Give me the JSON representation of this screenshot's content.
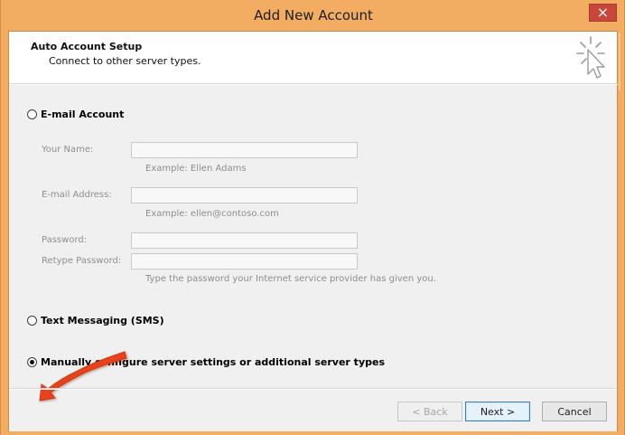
{
  "window": {
    "title": "Add New Account",
    "close_icon": "close-icon"
  },
  "header": {
    "title": "Auto Account Setup",
    "subtitle": "Connect to other server types.",
    "icon": "wizard-cursor-icon"
  },
  "options": {
    "email_account_label": "E-mail Account",
    "text_messaging_label": "Text Messaging (SMS)",
    "manual_label": "Manually configure server settings or additional server types"
  },
  "email_form": {
    "your_name_label": "Your Name:",
    "your_name_value": "",
    "your_name_example": "Example: Ellen Adams",
    "email_label": "E-mail Address:",
    "email_value": "",
    "email_example": "Example: ellen@contoso.com",
    "password_label": "Password:",
    "password_value": "",
    "retype_password_label": "Retype Password:",
    "retype_password_value": "",
    "password_hint": "Type the password your Internet service provider has given you."
  },
  "buttons": {
    "back": "< Back",
    "next": "Next >",
    "cancel": "Cancel"
  },
  "colors": {
    "window_frame": "#f2ad62",
    "close_button": "#c9473a",
    "content_bg": "#f0f0f0",
    "header_bg": "#ffffff",
    "arrow": "#e6431f"
  },
  "icons": {
    "annotation_arrow": "red-arrow-icon",
    "radio_selected": "radio-selected-icon",
    "radio_unselected": "radio-unselected-icon"
  }
}
